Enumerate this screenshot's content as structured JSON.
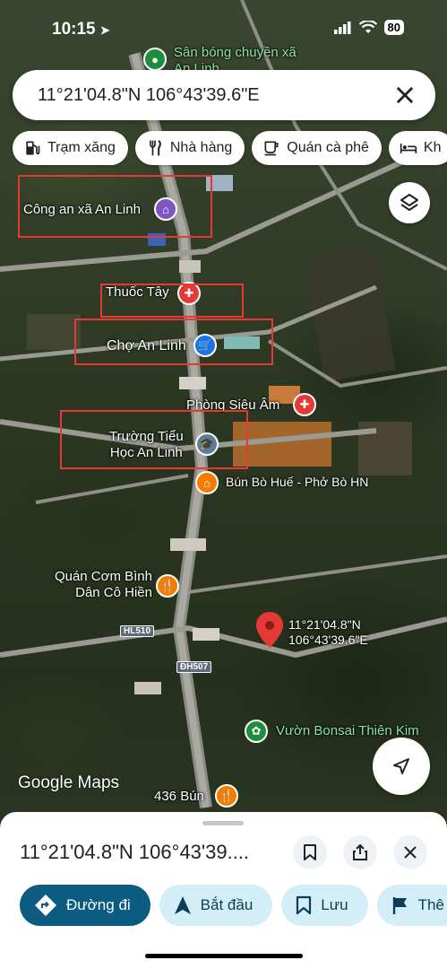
{
  "status": {
    "time": "10:15",
    "battery": "80"
  },
  "search": {
    "query": "11°21'04.8\"N 106°43'39.6\"E"
  },
  "chips": [
    {
      "label": "Trạm xăng",
      "icon": "gas-station-icon"
    },
    {
      "label": "Nhà hàng",
      "icon": "restaurant-icon"
    },
    {
      "label": "Quán cà phê",
      "icon": "coffee-icon"
    },
    {
      "label": "Kh",
      "icon": "hotel-icon"
    }
  ],
  "places": {
    "volleyball": "Sân bóng chuyền xã An Linh",
    "police": "Công an xã An Linh",
    "pharmacy": "Thuốc Tây",
    "market": "Chợ An Linh",
    "clinic": "Phòng Siêu Âm",
    "school_line1": "Trường Tiểu",
    "school_line2": "Học An Linh",
    "noodle": "Bún Bò Huế - Phở Bò HN",
    "rice_line1": "Quán Cơm Bình",
    "rice_line2": "Dân Cô Hiền",
    "bonsai": "Vườn Bonsai Thiên Kim",
    "bun436": "436 Bún",
    "pin_line1": "11°21'04.8\"N",
    "pin_line2": "106°43'39.6\"E"
  },
  "roads": {
    "hl510": "HL510",
    "dh507": "ĐH507"
  },
  "attribution": "Google Maps",
  "sheet": {
    "title": "11°21'04.8\"N 106°43'39....",
    "actions": [
      {
        "label": "Đường đi",
        "icon": "directions-icon"
      },
      {
        "label": "Bắt đầu",
        "icon": "navigate-icon"
      },
      {
        "label": "Lưu",
        "icon": "bookmark-icon"
      },
      {
        "label": "Thê",
        "icon": "flag-icon"
      }
    ]
  },
  "colors": {
    "accent": "#0b5c80",
    "action_bg": "#d3eef6",
    "highlight": "#e53935",
    "pin": "#e53935"
  }
}
